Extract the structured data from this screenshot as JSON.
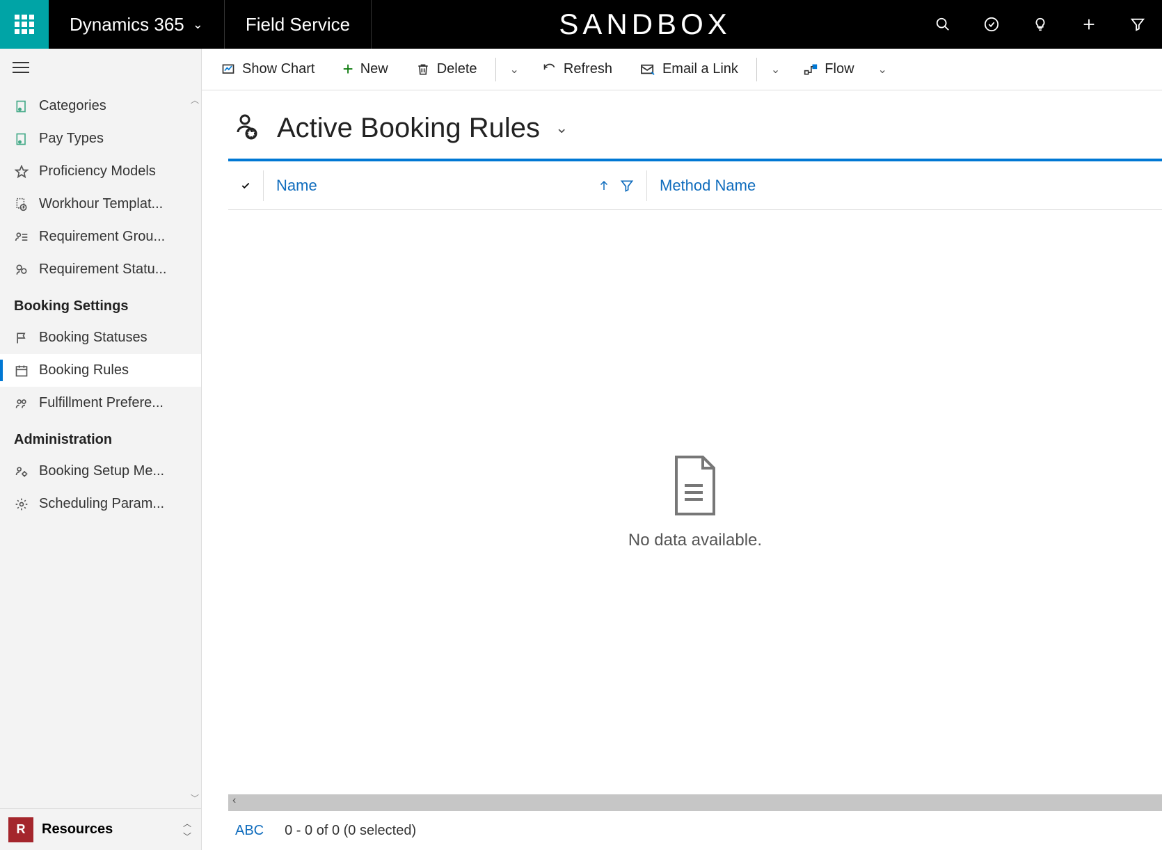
{
  "topbar": {
    "brand": "Dynamics 365",
    "module": "Field Service",
    "environment": "SANDBOX"
  },
  "sidebar": {
    "items_top": [
      {
        "label": "Categories",
        "icon": "category-icon"
      },
      {
        "label": "Pay Types",
        "icon": "paytype-icon"
      },
      {
        "label": "Proficiency Models",
        "icon": "star-icon"
      },
      {
        "label": "Workhour Templat...",
        "icon": "clock-doc-icon"
      },
      {
        "label": "Requirement Grou...",
        "icon": "req-group-icon"
      },
      {
        "label": "Requirement Statu...",
        "icon": "req-status-icon"
      }
    ],
    "group_booking_title": "Booking Settings",
    "items_booking": [
      {
        "label": "Booking Statuses",
        "icon": "flag-icon",
        "active": false
      },
      {
        "label": "Booking Rules",
        "icon": "calendar-icon",
        "active": true
      },
      {
        "label": "Fulfillment Prefere...",
        "icon": "people-icon",
        "active": false
      }
    ],
    "group_admin_title": "Administration",
    "items_admin": [
      {
        "label": "Booking Setup Me...",
        "icon": "gear-people-icon"
      },
      {
        "label": "Scheduling Param...",
        "icon": "gear-icon"
      }
    ],
    "area_badge": "R",
    "area_label": "Resources"
  },
  "cmdbar": {
    "show_chart": "Show Chart",
    "new": "New",
    "delete": "Delete",
    "refresh": "Refresh",
    "email_link": "Email a Link",
    "flow": "Flow"
  },
  "view": {
    "title": "Active Booking Rules"
  },
  "grid": {
    "col_name": "Name",
    "col_method": "Method Name",
    "empty": "No data available."
  },
  "footer": {
    "abc": "ABC",
    "paging": "0 - 0 of 0 (0 selected)"
  }
}
